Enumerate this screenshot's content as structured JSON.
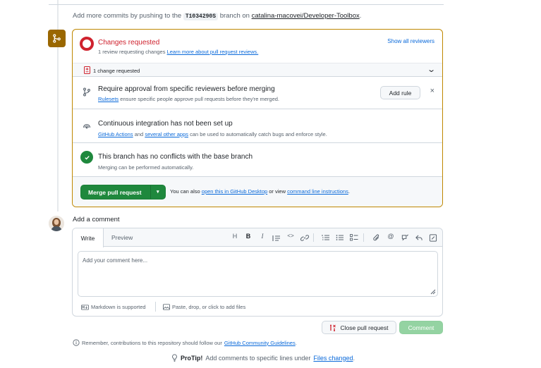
{
  "commit_hint": {
    "prefix": "Add more commits by pushing to the",
    "branch": "T1034290S",
    "middle": "branch on",
    "repo": "catalina-macovei/Developer-Toolbox",
    "suffix": "."
  },
  "merge_box": {
    "review": {
      "title": "Changes requested",
      "subtitle": "1 review requesting changes",
      "learn_more": "Learn more about pull request reviews.",
      "show_all": "Show all reviewers"
    },
    "change_summary": "1 change requested",
    "approval_rule": {
      "title": "Require approval from specific reviewers before merging",
      "link": "Rulesets",
      "subtitle": "ensure specific people approve pull requests before they're merged.",
      "add_rule": "Add rule",
      "dismiss": "×"
    },
    "ci": {
      "title": "Continuous integration has not been set up",
      "link1": "GitHub Actions",
      "and": "and",
      "link2": "several other apps",
      "subtitle": "can be used to automatically catch bugs and enforce style."
    },
    "conflicts": {
      "title": "This branch has no conflicts with the base branch",
      "subtitle": "Merging can be performed automatically."
    },
    "merge": {
      "button": "Merge pull request",
      "also_prefix": "You can also",
      "desktop_link": "open this in GitHub Desktop",
      "or_view": "or view",
      "cli_link": "command line instructions",
      "suffix": "."
    }
  },
  "comment": {
    "heading": "Add a comment",
    "tabs": [
      "Write",
      "Preview"
    ],
    "toolbar": [
      "H",
      "B",
      "I",
      "quote",
      "code",
      "link",
      "ordered-list",
      "unordered-list",
      "task-list",
      "attach",
      "mention",
      "reference",
      "undo",
      "fullscreen"
    ],
    "placeholder": "Add your comment here...",
    "markdown": "Markdown is supported",
    "attach": "Paste, drop, or click to add files",
    "close_pr": "Close pull request",
    "submit": "Comment"
  },
  "footer": {
    "remember": "Remember, contributions to this repository should follow our",
    "guidelines_link": "GitHub Community Guidelines",
    "remember_suffix": ".",
    "protip_label": "ProTip!",
    "protip_text": "Add comments to specific lines under",
    "protip_link": "Files changed",
    "protip_suffix": "."
  },
  "colors": {
    "accent": "#0969da",
    "danger": "#cf222e",
    "success": "#1f883d",
    "attention": "#9a6700",
    "border": "#d0d7de"
  }
}
